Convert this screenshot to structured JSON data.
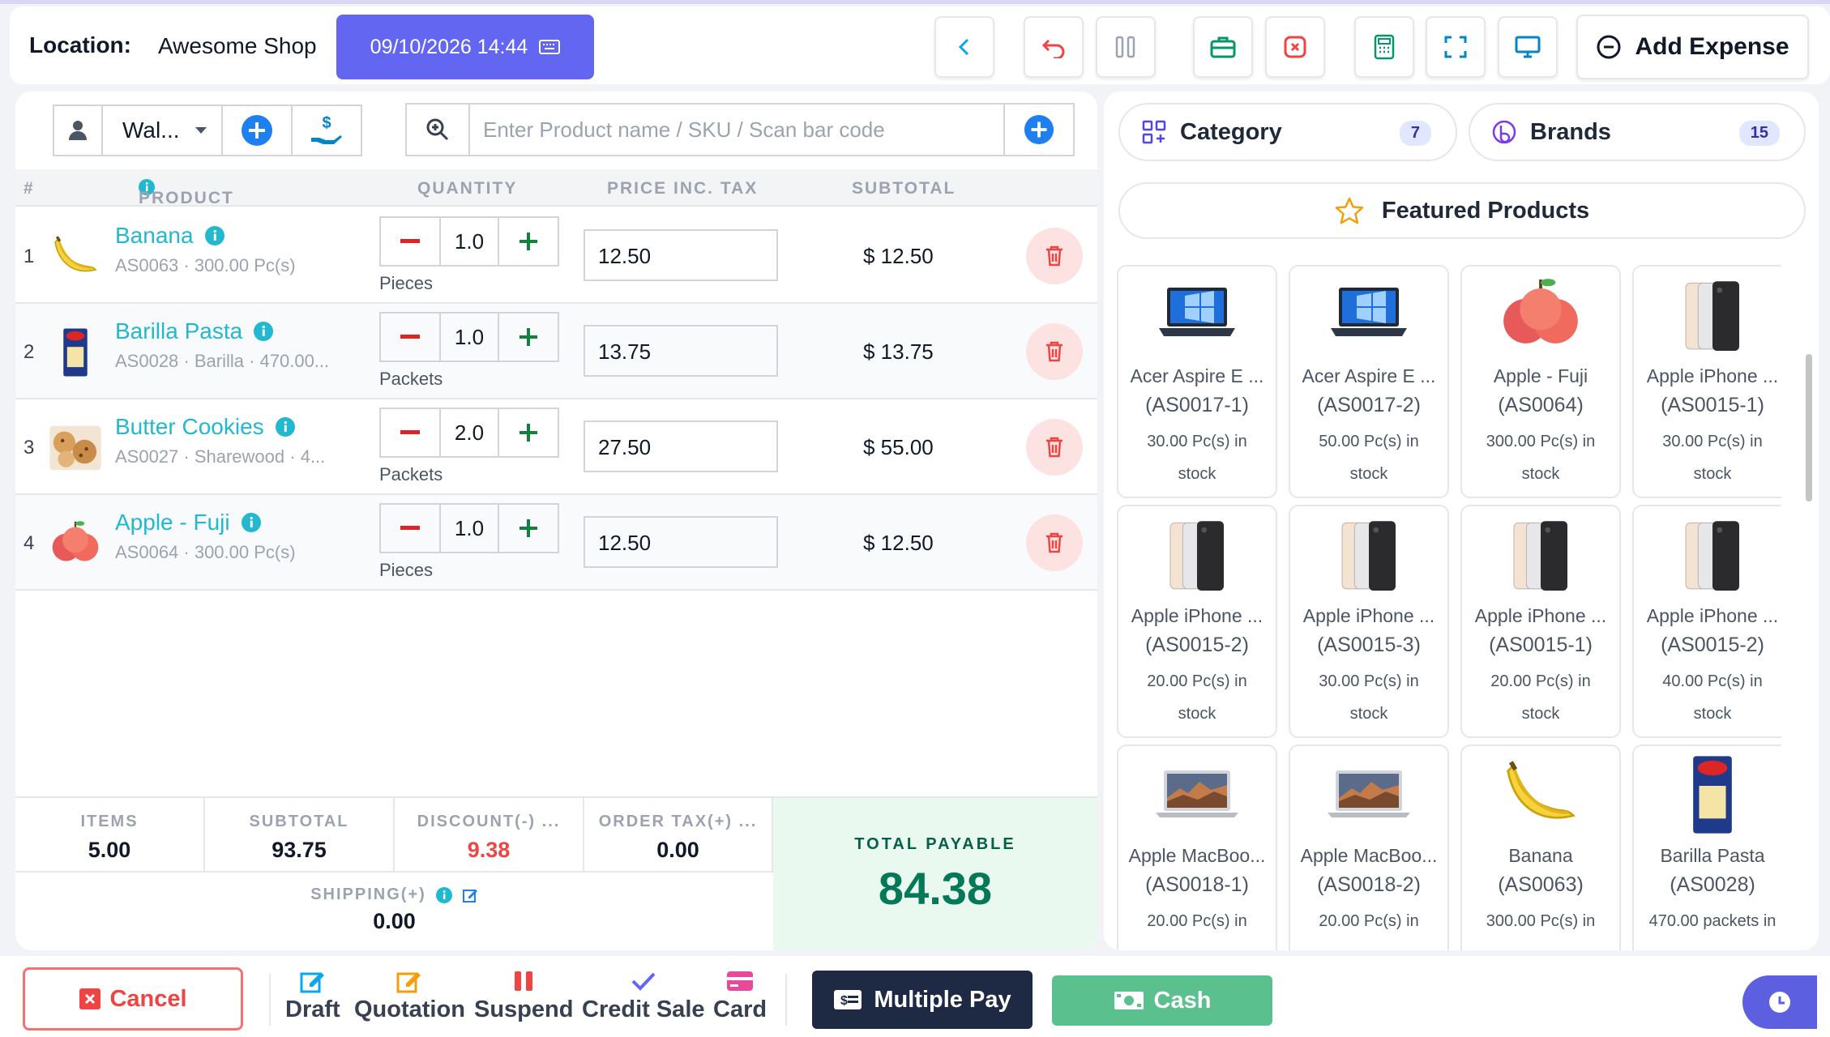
{
  "header": {
    "location_label": "Location:",
    "location_value": "Awesome Shop",
    "datetime": "09/10/2026 14:44",
    "add_expense_label": "Add Expense"
  },
  "customer": {
    "selected": "Wal..."
  },
  "search": {
    "placeholder": "Enter Product name / SKU / Scan bar code"
  },
  "table": {
    "headers": {
      "num": "#",
      "product": "PRODUCT",
      "quantity": "QUANTITY",
      "price": "PRICE INC. TAX",
      "subtotal": "SUBTOTAL"
    },
    "rows": [
      {
        "num": "1",
        "name": "Banana",
        "sub": "AS0063  ·  300.00 Pc(s)",
        "qty": "1.0",
        "unit": "Pieces",
        "price": "12.50",
        "subtotal": "$ 12.50",
        "img": "banana"
      },
      {
        "num": "2",
        "name": "Barilla Pasta",
        "sub": "AS0028 · Barilla  ·  470.00...",
        "qty": "1.0",
        "unit": "Packets",
        "price": "13.75",
        "subtotal": "$ 13.75",
        "img": "pasta"
      },
      {
        "num": "3",
        "name": "Butter Cookies",
        "sub": "AS0027 · Sharewood  ·  4...",
        "qty": "2.0",
        "unit": "Packets",
        "price": "27.50",
        "subtotal": "$ 55.00",
        "img": "cookies"
      },
      {
        "num": "4",
        "name": "Apple - Fuji",
        "sub": "AS0064  ·  300.00 Pc(s)",
        "qty": "1.0",
        "unit": "Pieces",
        "price": "12.50",
        "subtotal": "$ 12.50",
        "img": "apple"
      }
    ]
  },
  "summary": {
    "items_label": "ITEMS",
    "items": "5.00",
    "subtotal_label": "SUBTOTAL",
    "subtotal": "93.75",
    "discount_label": "DISCOUNT(-) ...",
    "discount": "9.38",
    "tax_label": "ORDER TAX(+) ...",
    "tax": "0.00",
    "shipping_label": "SHIPPING(+)",
    "shipping": "0.00",
    "total_label": "TOTAL PAYABLE",
    "total": "84.38"
  },
  "filters": {
    "category_label": "Category",
    "category_count": "7",
    "brands_label": "Brands",
    "brands_count": "15",
    "featured_label": "Featured Products"
  },
  "products": [
    {
      "name": "Acer Aspire E ...",
      "sku": "(AS0017-1)",
      "stock1": "30.00 Pc(s) in",
      "stock2": "stock",
      "img": "laptop"
    },
    {
      "name": "Acer Aspire E ...",
      "sku": "(AS0017-2)",
      "stock1": "50.00 Pc(s) in",
      "stock2": "stock",
      "img": "laptop"
    },
    {
      "name": "Apple - Fuji",
      "sku": "(AS0064)",
      "stock1": "300.00 Pc(s) in",
      "stock2": "stock",
      "img": "apple"
    },
    {
      "name": "Apple iPhone ...",
      "sku": "(AS0015-1)",
      "stock1": "30.00 Pc(s) in",
      "stock2": "stock",
      "img": "phone"
    },
    {
      "name": "Apple iPhone ...",
      "sku": "(AS0015-2)",
      "stock1": "20.00 Pc(s) in",
      "stock2": "stock",
      "img": "phone"
    },
    {
      "name": "Apple iPhone ...",
      "sku": "(AS0015-3)",
      "stock1": "30.00 Pc(s) in",
      "stock2": "stock",
      "img": "phone"
    },
    {
      "name": "Apple iPhone ...",
      "sku": "(AS0015-1)",
      "stock1": "20.00 Pc(s) in",
      "stock2": "stock",
      "img": "phone"
    },
    {
      "name": "Apple iPhone ...",
      "sku": "(AS0015-2)",
      "stock1": "40.00 Pc(s) in",
      "stock2": "stock",
      "img": "phone"
    },
    {
      "name": "Apple MacBoo...",
      "sku": "(AS0018-1)",
      "stock1": "20.00 Pc(s) in",
      "stock2": "",
      "img": "macbook"
    },
    {
      "name": "Apple MacBoo...",
      "sku": "(AS0018-2)",
      "stock1": "20.00 Pc(s) in",
      "stock2": "",
      "img": "macbook"
    },
    {
      "name": "Banana",
      "sku": "(AS0063)",
      "stock1": "300.00 Pc(s) in",
      "stock2": "",
      "img": "banana"
    },
    {
      "name": "Barilla Pasta",
      "sku": "(AS0028)",
      "stock1": "470.00 packets in",
      "stock2": "",
      "img": "pasta"
    }
  ],
  "actions": {
    "cancel": "Cancel",
    "draft": "Draft",
    "quotation": "Quotation",
    "suspend": "Suspend",
    "credit_sale": "Credit Sale",
    "card": "Card",
    "multiple_pay": "Multiple Pay",
    "cash": "Cash"
  },
  "colors": {
    "accent": "#6366f1",
    "link": "#22b8cf",
    "danger": "#ef4444",
    "success": "#047857",
    "dark_button": "#1e2a44",
    "cash_button": "#5ac18e"
  }
}
